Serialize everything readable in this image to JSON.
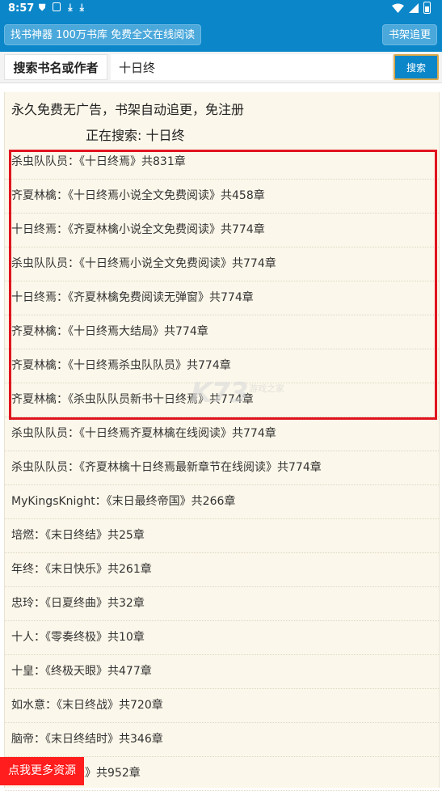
{
  "status_bar": {
    "time": "8:57"
  },
  "app_bar": {
    "left_button": "找书神器 100万书库 免费全文在线阅读",
    "right_button": "书架追更"
  },
  "search": {
    "label": "搜索书名或作者",
    "value": "十日终",
    "button": "搜索"
  },
  "content": {
    "headline": "永久免费无广告，书架自动追更，免注册",
    "searching": "正在搜索: 十日终"
  },
  "results": [
    "杀虫队队员：《十日终焉》共831章",
    "齐夏林檎：《十日终焉小说全文免费阅读》共458章",
    "十日终焉：《齐夏林檎小说全文免费阅读》共774章",
    "杀虫队队员：《十日终焉小说全文免费阅读》共774章",
    "十日终焉：《齐夏林檎免费阅读无弹窗》共774章",
    "齐夏林檎：《十日终焉大结局》共774章",
    "齐夏林檎：《十日终焉杀虫队队员》共774章",
    "齐夏林檎：《杀虫队队员新书十日终焉》共774章",
    "杀虫队队员：《十日终焉齐夏林檎在线阅读》共774章",
    "杀虫队队员：《齐夏林檎十日终焉最新章节在线阅读》共774章",
    "MyKingsKnight：《末日最终帝国》共266章",
    "培燃：《末日终结》共25章",
    "年终：《末日快乐》共261章",
    "忠玲：《日夏终曲》共32章",
    "十人：《零奏终极》共10章",
    "十皇：《终极天眼》共477章",
    "如水意：《末日终战》共720章",
    "脑帝：《末日终结时》共346章",
    "…：《…峰医圣》共952章"
  ],
  "watermark": {
    "logo": "K73",
    "sub": "游戏之家"
  },
  "more_button": "点我更多资源",
  "colors": {
    "primary": "#0a86c9",
    "highlight": "#e0141e",
    "content_bg": "#fbf7ea",
    "more": "#ff1d1d"
  }
}
